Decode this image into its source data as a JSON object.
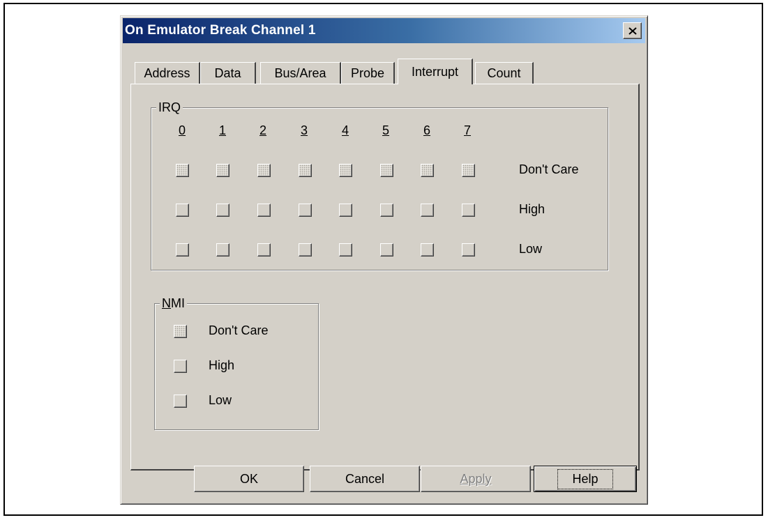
{
  "window": {
    "title": "On Emulator Break Channel 1",
    "close_icon": "close-icon"
  },
  "tabs": [
    {
      "label": "Address",
      "active": false
    },
    {
      "label": "Data",
      "active": false
    },
    {
      "label": "Bus/Area",
      "active": false
    },
    {
      "label": "Probe",
      "active": false
    },
    {
      "label": "Interrupt",
      "active": true
    },
    {
      "label": "Count",
      "active": false
    }
  ],
  "irq": {
    "legend": "IRQ",
    "columns": [
      "0",
      "1",
      "2",
      "3",
      "4",
      "5",
      "6",
      "7"
    ],
    "rows": [
      {
        "label": "Don't Care",
        "state": "indeterminate"
      },
      {
        "label": "High",
        "state": "unchecked"
      },
      {
        "label": "Low",
        "state": "unchecked"
      }
    ]
  },
  "nmi": {
    "legend": "NMI",
    "options": [
      {
        "label": "Don't Care",
        "state": "indeterminate"
      },
      {
        "label": "High",
        "state": "unchecked"
      },
      {
        "label": "Low",
        "state": "unchecked"
      }
    ]
  },
  "buttons": {
    "ok": "OK",
    "cancel": "Cancel",
    "apply": "Apply",
    "help": "Help"
  }
}
